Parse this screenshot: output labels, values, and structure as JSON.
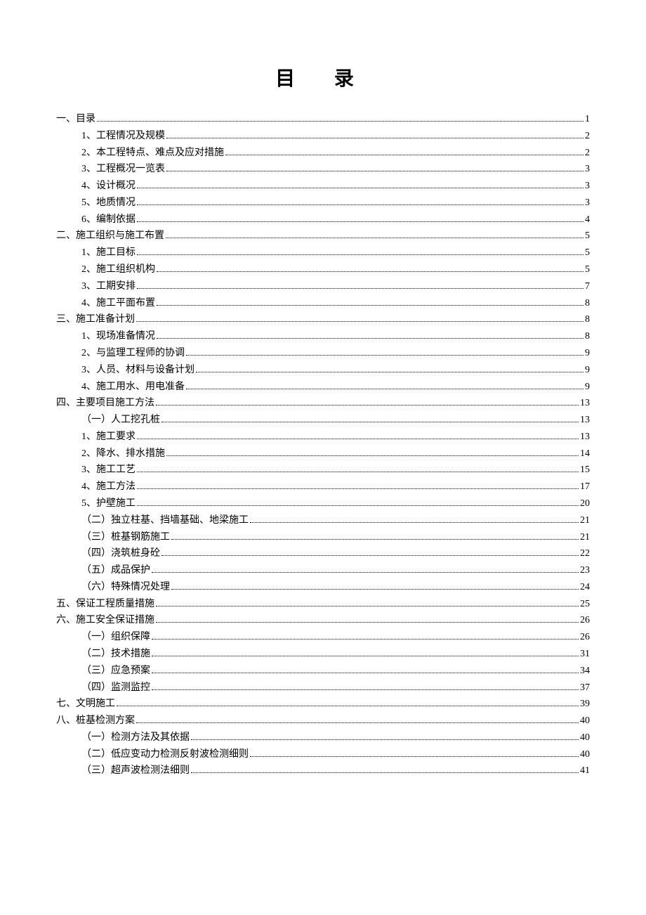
{
  "title": "目 录",
  "entries": [
    {
      "level": 0,
      "label": "一、目录",
      "page": "1"
    },
    {
      "level": 1,
      "label": "1、工程情况及规模",
      "page": "2"
    },
    {
      "level": 1,
      "label": "2、本工程特点、难点及应对措施",
      "page": "2"
    },
    {
      "level": 1,
      "label": "3、工程概况一览表",
      "page": "3"
    },
    {
      "level": 1,
      "label": "4、设计概况",
      "page": "3"
    },
    {
      "level": 1,
      "label": "5、地质情况",
      "page": "3"
    },
    {
      "level": 1,
      "label": "6、编制依据",
      "page": "4"
    },
    {
      "level": 0,
      "label": "二、施工组织与施工布置",
      "page": "5"
    },
    {
      "level": 1,
      "label": "1、施工目标",
      "page": "5"
    },
    {
      "level": 1,
      "label": "2、施工组织机构",
      "page": "5"
    },
    {
      "level": 1,
      "label": "3、工期安排",
      "page": "7"
    },
    {
      "level": 1,
      "label": "4、施工平面布置",
      "page": "8"
    },
    {
      "level": 0,
      "label": "三、施工准备计划",
      "page": "8"
    },
    {
      "level": 1,
      "label": "1、现场准备情况",
      "page": "8"
    },
    {
      "level": 1,
      "label": "2、与监理工程师的协调",
      "page": "9"
    },
    {
      "level": 1,
      "label": "3、人员、材料与设备计划",
      "page": "9"
    },
    {
      "level": 1,
      "label": "4、施工用水、用电准备",
      "page": "9"
    },
    {
      "level": 0,
      "label": "四、主要项目施工方法",
      "page": "13"
    },
    {
      "level": 1,
      "label": "（一）人工挖孔桩",
      "page": "13"
    },
    {
      "level": 1,
      "label": "1、施工要求",
      "page": "13"
    },
    {
      "level": 1,
      "label": "2、降水、排水措施",
      "page": "14"
    },
    {
      "level": 1,
      "label": "3、施工工艺",
      "page": "15"
    },
    {
      "level": 1,
      "label": "4、施工方法",
      "page": "17"
    },
    {
      "level": 1,
      "label": "5、护壁施工",
      "page": "20"
    },
    {
      "level": 1,
      "label": "（二）独立柱基、挡墙基础、地梁施工",
      "page": "21"
    },
    {
      "level": 1,
      "label": "（三）桩基钢筋施工",
      "page": "21"
    },
    {
      "level": 1,
      "label": "（四）浇筑桩身砼",
      "page": "22"
    },
    {
      "level": 1,
      "label": "（五）成品保护",
      "page": "23"
    },
    {
      "level": 1,
      "label": "（六）特殊情况处理",
      "page": "24"
    },
    {
      "level": 0,
      "label": "五、保证工程质量措施",
      "page": "25"
    },
    {
      "level": 0,
      "label": "六、施工安全保证措施",
      "page": "26"
    },
    {
      "level": 1,
      "label": "（一）组织保障",
      "page": "26"
    },
    {
      "level": 1,
      "label": "（二）技术措施",
      "page": "31"
    },
    {
      "level": 1,
      "label": "（三）应急预案",
      "page": "34"
    },
    {
      "level": 1,
      "label": "（四）监测监控",
      "page": "37"
    },
    {
      "level": 0,
      "label": "七、文明施工",
      "page": "39"
    },
    {
      "level": 0,
      "label": "八、桩基检测方案",
      "page": "40"
    },
    {
      "level": 1,
      "label": "（一）检测方法及其依据",
      "page": "40"
    },
    {
      "level": 1,
      "label": "（二）低应变动力检测反射波检测细则",
      "page": "40"
    },
    {
      "level": 1,
      "label": "（三）超声波检测法细则",
      "page": "41"
    }
  ]
}
